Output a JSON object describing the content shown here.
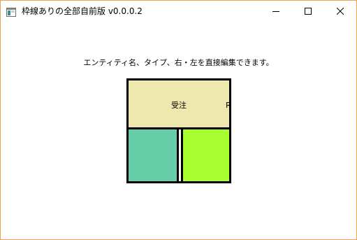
{
  "window": {
    "title": "枠線ありの全部自前版 v0.0.0.2",
    "icon": "app-window-icon",
    "controls": {
      "minimize_icon": "minimize-icon",
      "maximize_icon": "maximize-icon",
      "close_icon": "close-icon"
    }
  },
  "content": {
    "instruction": "エンティティ名、タイプ、右・左を直接編集できます。",
    "entity": {
      "name": "受注",
      "type": "R",
      "left": "",
      "right": "",
      "colors": {
        "name_bg": "#efe8ae",
        "left_bg": "#66cda9",
        "right_bg": "#a8ff30",
        "border": "#000000"
      }
    }
  }
}
